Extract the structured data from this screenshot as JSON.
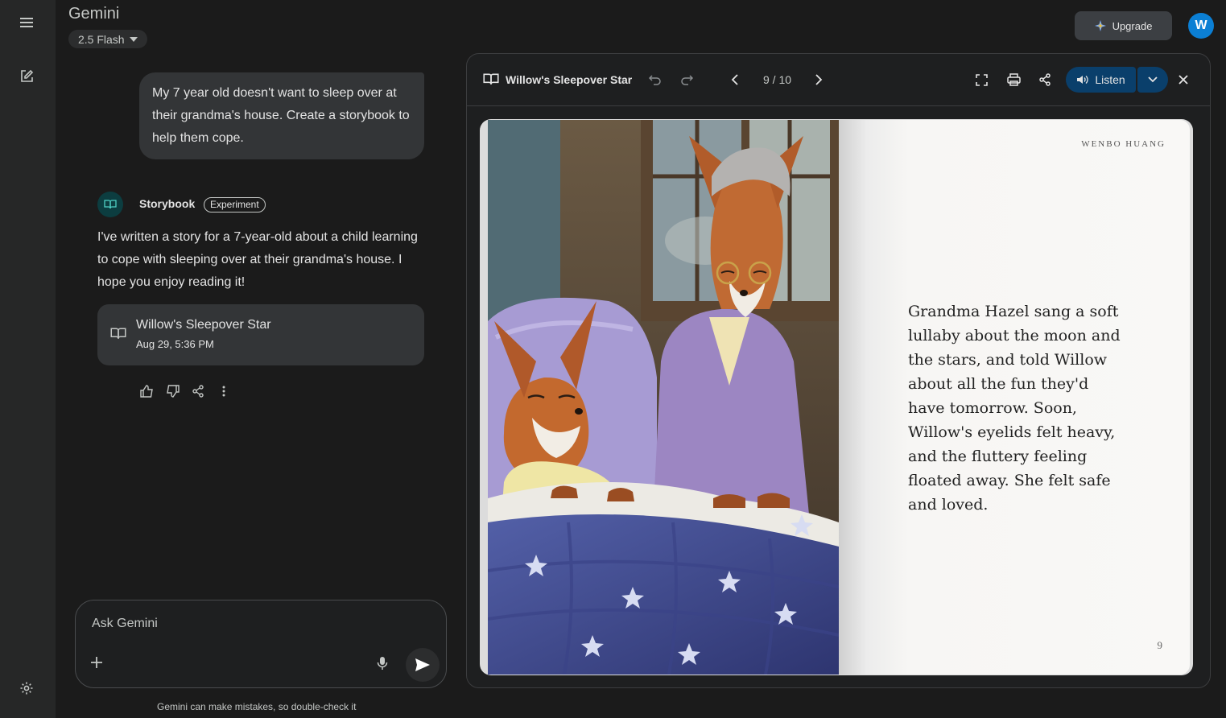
{
  "app": {
    "title": "Gemini",
    "model": "2.5 Flash"
  },
  "header": {
    "upgrade_label": "Upgrade",
    "avatar_initial": "W"
  },
  "chat": {
    "user_message": "My 7 year old doesn't want to sleep over at their grandma's house. Create a storybook to help them cope.",
    "assistant_name": "Storybook",
    "assistant_badge": "Experiment",
    "assistant_reply": "I've written a story for a 7-year-old about a child learning to cope with sleeping over at their grandma's house. I hope you enjoy reading it!",
    "card": {
      "title": "Willow's Sleepover Star",
      "date": "Aug 29, 5:36 PM"
    }
  },
  "input": {
    "placeholder": "Ask Gemini"
  },
  "disclaimer": "Gemini can make mistakes, so double-check it",
  "viewer": {
    "title": "Willow's Sleepover Star",
    "page_indicator": "9 / 10",
    "listen_label": "Listen",
    "author": "WENBO HUANG",
    "page_text": "Grandma Hazel sang a soft lullaby about the moon and the stars, and told Willow about all the fun they'd have tomorrow. Soon, Willow's eyelids felt heavy, and the fluttery feeling floated away. She felt safe and loved.",
    "page_number": "9"
  },
  "colors": {
    "accent": "#0b7fd4",
    "listen_bg": "#0a3f6b",
    "background": "#1b1b1b"
  }
}
